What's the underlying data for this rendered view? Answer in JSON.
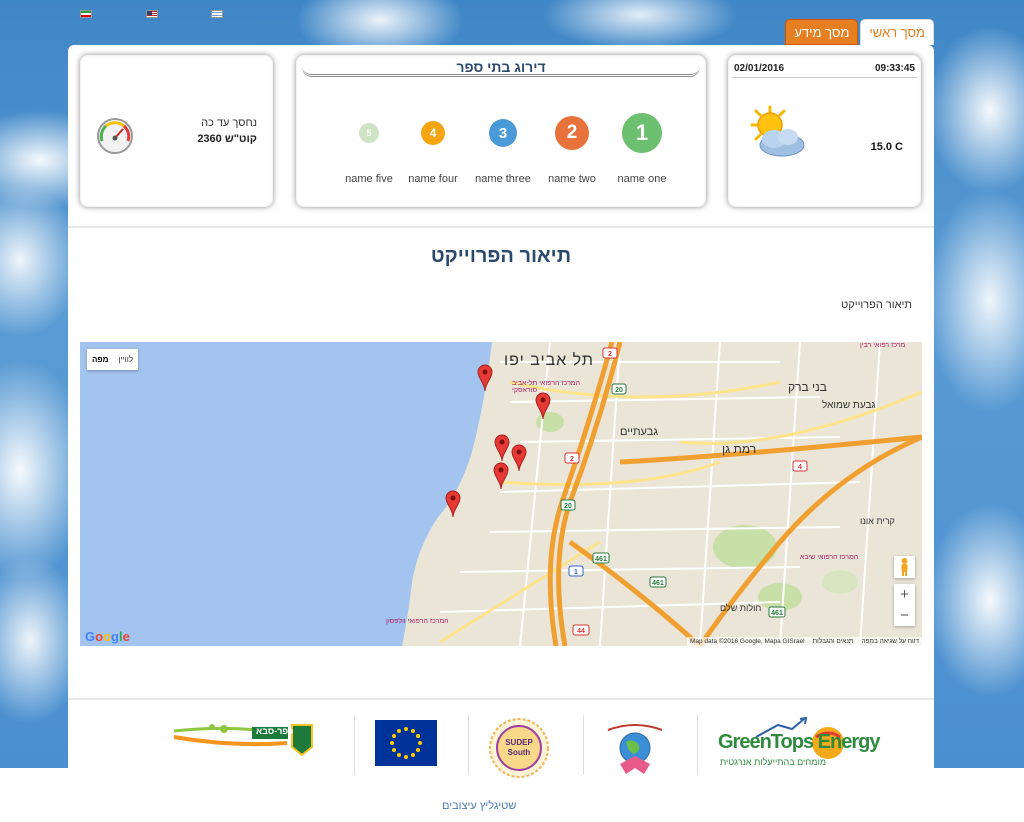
{
  "language_flags": [
    {
      "name": "flag-iran",
      "icon": "flag-iran-icon"
    },
    {
      "name": "flag-usa",
      "icon": "flag-usa-icon"
    },
    {
      "name": "flag-israel",
      "icon": "flag-israel-icon"
    }
  ],
  "tabs": {
    "main_label": "מסך ראשי",
    "info_label": "מסך מידע"
  },
  "weather": {
    "date": "02/01/2016",
    "time": "09:33:45",
    "temperature": "15.0  C",
    "icon": "partly-cloudy-sun-icon"
  },
  "ranking": {
    "title": "דירוג בתי ספר",
    "items": [
      {
        "rank": "1",
        "name": "name one",
        "color": "#6cc070"
      },
      {
        "rank": "2",
        "name": "name two",
        "color": "#e8733a"
      },
      {
        "rank": "3",
        "name": "name three",
        "color": "#4a9ad8"
      },
      {
        "rank": "4",
        "name": "name four",
        "color": "#f5a412"
      },
      {
        "rank": "5",
        "name": "name five",
        "color": "#cfe3c5"
      }
    ]
  },
  "savings": {
    "label": "נחסך עד כה",
    "value": "2360 קוט\"ש",
    "icon": "gauge-icon"
  },
  "project": {
    "title": "תיאור הפרוייקט",
    "description": "תיאור הפרוייקט"
  },
  "map": {
    "type_map_label": "מפה",
    "type_satellite_label": "לוויין",
    "attribution": "Map data ©2016 Google, Mapa GISrael",
    "terms_label": "תנאים והגבלות",
    "report_label": "דווח על שגיאה במפה",
    "google_label": "Google",
    "zoom_in": "+",
    "zoom_out": "−",
    "place_labels": {
      "tel_aviv": "תל אביב יפו",
      "bnei_brak": "בני ברק",
      "ramat_gan": "רמת גן",
      "givatayim": "גבעתיים",
      "givat_shmuel": "גבעת שמואל",
      "kiryat_ono": "קרית אונו",
      "holon": "חולות שלם",
      "sheba": "המרכז הרפואי שיבא",
      "wolfson": "המרכז הרפואי וולפסון",
      "ichilov": "המרכז הרפואי תל-אביב סוראסקי",
      "rabin": "מרכז רפואי רבין"
    },
    "road_numbers": [
      "2",
      "20",
      "2",
      "20",
      "4",
      "461",
      "1",
      "461",
      "44",
      "461"
    ]
  },
  "partners": [
    {
      "name": "kfar-saba-logo",
      "text": "כפר-סבא",
      "icon": "kfar-saba-emblem-icon"
    },
    {
      "name": "eu-flag-logo",
      "icon": "eu-flag-icon"
    },
    {
      "name": "sudep-south-logo",
      "text": "SUDEP South",
      "icon": "sudep-seal-icon"
    },
    {
      "name": "globe-ribbon-logo",
      "icon": "globe-ribbon-icon"
    },
    {
      "name": "greentops-logo",
      "text": "GreenTops Energy",
      "subtext": "מומחים בהתייעלות אנרגטית",
      "icon": "greentops-icon"
    }
  ],
  "footer": {
    "credit_link": "שטיגליץ עיצובים"
  }
}
